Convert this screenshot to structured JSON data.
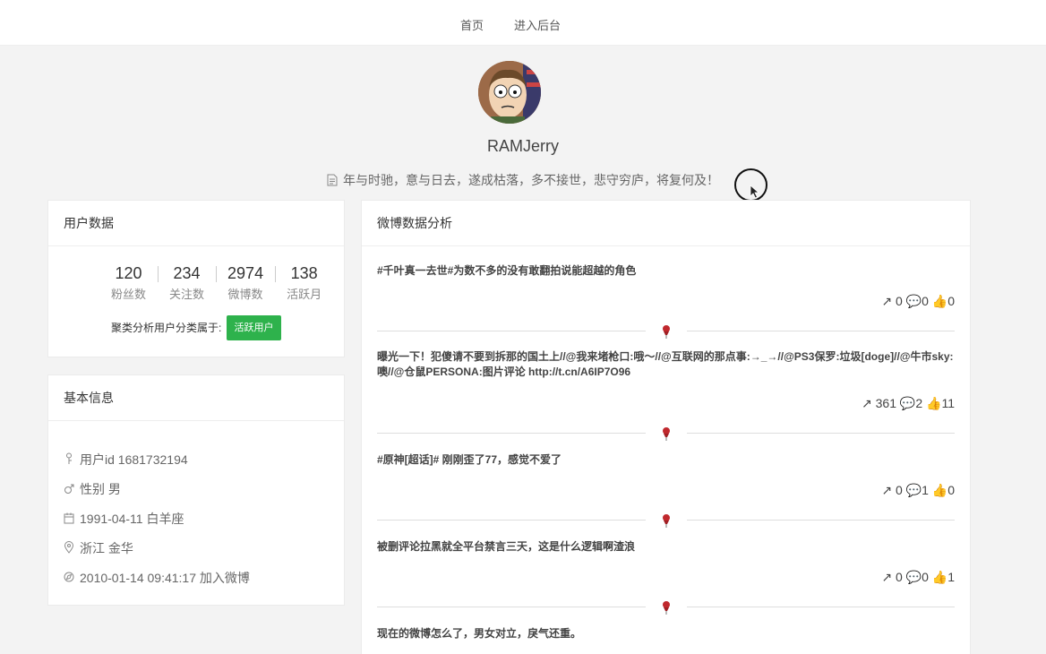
{
  "nav": {
    "home": "首页",
    "admin": "进入后台"
  },
  "profile": {
    "username": "RAMJerry",
    "signature": "年与时驰，意与日去，遂成枯落，多不接世，悲守穷庐，将复何及！"
  },
  "user_data": {
    "title": "用户数据",
    "stats": [
      {
        "value": "120",
        "label": "粉丝数"
      },
      {
        "value": "234",
        "label": "关注数"
      },
      {
        "value": "2974",
        "label": "微博数"
      },
      {
        "value": "138",
        "label": "活跃月"
      }
    ],
    "cluster_label": "聚类分析用户分类属于:",
    "cluster_badge": "活跃用户"
  },
  "basic_info": {
    "title": "基本信息",
    "user_id": "用户id 1681732194",
    "gender": "性别 男",
    "birthday": "1991-04-11 白羊座",
    "location": "浙江 金华",
    "joined": "2010-01-14 09:41:17 加入微博"
  },
  "weibo": {
    "title": "微博数据分析",
    "posts": [
      {
        "text": "#千叶真一去世#为数不多的没有敢翻拍说能超越的角色",
        "reposts": "0",
        "comments": "0",
        "likes": "0"
      },
      {
        "text": "曝光一下！犯傻请不要到拆那的国土上//@我来堵枪口:哦～//@互联网的那点事:→_→//@PS3保罗:垃圾[doge]//@牛市sky:噢//@仓鼠PERSONA:图片评论 http://t.cn/A6IP7O96",
        "reposts": "361",
        "comments": "2",
        "likes": "11"
      },
      {
        "text": "#原神[超话]# 刚刚歪了77，感觉不爱了",
        "reposts": "0",
        "comments": "1",
        "likes": "0"
      },
      {
        "text": "被删评论拉黑就全平台禁言三天，这是什么逻辑啊渣浪",
        "reposts": "0",
        "comments": "0",
        "likes": "1"
      },
      {
        "text": "现在的微博怎么了，男女对立，戾气还重。"
      }
    ]
  },
  "colors": {
    "accent_green": "#2eb24c",
    "page_bg": "#f3f3f3"
  }
}
